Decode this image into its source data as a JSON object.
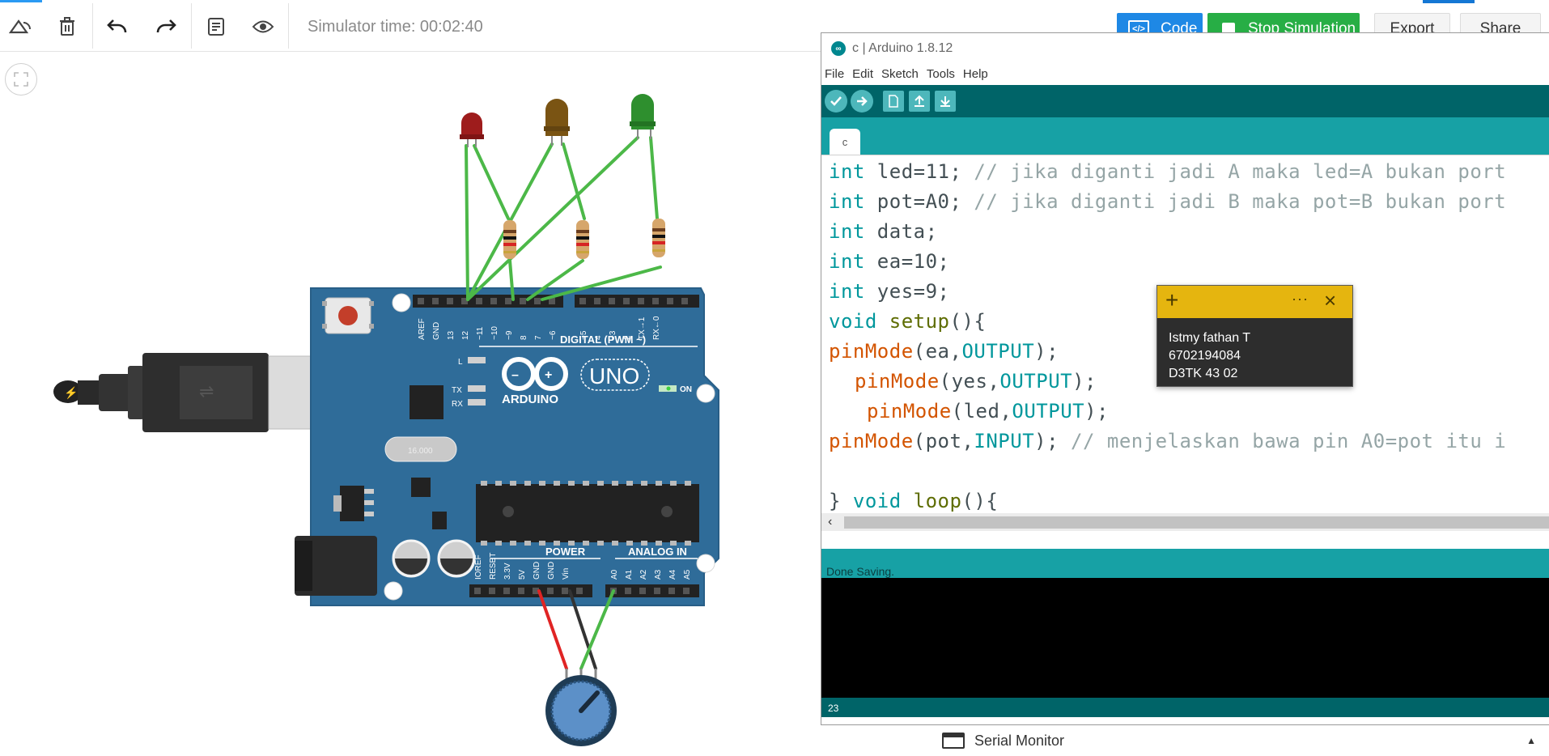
{
  "toolbar": {
    "simulator_time": "Simulator time: 00:02:40",
    "code_label": "Code",
    "stop_label": "Stop Simulation",
    "export_label": "Export",
    "share_label": "Share"
  },
  "ide": {
    "title": "c | Arduino 1.8.12",
    "menu": [
      "File",
      "Edit",
      "Sketch",
      "Tools",
      "Help"
    ],
    "tab": "c",
    "status": "Done Saving.",
    "line_number": "23",
    "code": {
      "l1": {
        "kw": "int",
        "rest": " led=11; ",
        "cmt": "// jika diganti jadi A maka led=A bukan port"
      },
      "l2": {
        "kw": "int",
        "rest": " pot=A0; ",
        "cmt": "// jika diganti jadi B maka pot=B bukan port"
      },
      "l3": {
        "kw": "int",
        "rest": " data;"
      },
      "l4": {
        "kw": "int",
        "rest": " ea=10;"
      },
      "l5": {
        "kw": "int",
        "rest": " yes=9;"
      },
      "l6": {
        "kw": "void",
        "fn": "setup",
        "rest": "(){"
      },
      "l7": {
        "fn": "pinMode",
        "a": "(ea,",
        "kw": "OUTPUT",
        "b": ");"
      },
      "l8": {
        "fn": "pinMode",
        "a": "(yes,",
        "kw": "OUTPUT",
        "b": ");"
      },
      "l9": {
        "fn": "pinMode",
        "a": "(led,",
        "kw": "OUTPUT",
        "b": ");"
      },
      "l10": {
        "fn": "pinMode",
        "a": "(pot,",
        "kw": "INPUT",
        "b": "); ",
        "cmt": "// menjelaskan bawa pin A0=pot itu i"
      },
      "l12": {
        "a": "} ",
        "kw": "void",
        "fn": "loop",
        "b": "(){"
      }
    }
  },
  "note": {
    "line1": "Istmy fathan T",
    "line2": "6702194084",
    "line3": "D3TK 43 02"
  },
  "serial_monitor": "Serial Monitor",
  "board": {
    "brand": "ARDUINO",
    "model": "UNO",
    "digital_label": "DIGITAL (PWM ~)",
    "power_label": "POWER",
    "analog_label": "ANALOG IN",
    "on_label": "ON",
    "l_label": "L",
    "tx_label": "TX",
    "rx_label": "RX",
    "crystal": "16.000",
    "top_pins": [
      "AREF",
      "GND",
      "13",
      "12",
      "~11",
      "~10",
      "~9",
      "8",
      "7",
      "~6",
      "~5",
      "4",
      "~3",
      "2",
      "TX→1",
      "RX←0"
    ],
    "bottom_pins": [
      "IOREF",
      "RESET",
      "3.3V",
      "5V",
      "GND",
      "GND",
      "Vin",
      "A0",
      "A1",
      "A2",
      "A3",
      "A4",
      "A5"
    ]
  },
  "colors": {
    "code_button": "#1e88e5",
    "stop_button": "#27ae45",
    "ide_teal": "#006468",
    "ide_teal_light": "#17a1a5",
    "board_blue": "#2f6c99",
    "wire_green": "#4cb848",
    "wire_red": "#e02424",
    "note_yellow": "#e5b50f"
  },
  "icons": [
    "rotate-icon",
    "delete-icon",
    "undo-icon",
    "redo-icon",
    "notes-icon",
    "visibility-icon",
    "code-icon",
    "fit-view-icon",
    "arduino-logo-icon",
    "verify-icon",
    "upload-icon",
    "new-icon",
    "open-icon",
    "save-icon",
    "serial-monitor-icon"
  ]
}
